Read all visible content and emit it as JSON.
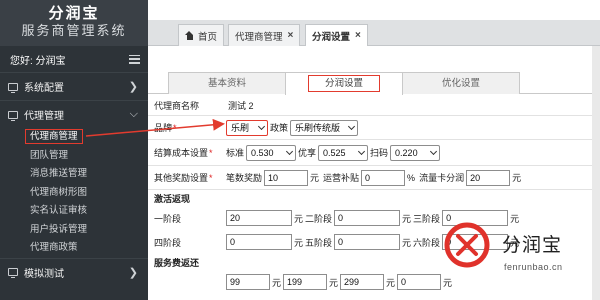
{
  "sidebar": {
    "brand_name": "分润宝",
    "brand_subtitle": "服务商管理系统",
    "greeting": "您好:  分润宝",
    "sections": [
      {
        "label": "系统配置",
        "icon": "monitor-icon"
      },
      {
        "label": "代理管理",
        "icon": "monitor-icon"
      },
      {
        "label": "模拟测试",
        "icon": "monitor-icon"
      }
    ],
    "agent_items": [
      "代理商管理",
      "团队管理",
      "消息推送管理",
      "代理商树形图",
      "实名认证审核",
      "用户投诉管理",
      "代理商政策"
    ]
  },
  "tabs": [
    {
      "label": "首页",
      "icon": "home-icon"
    },
    {
      "label": "代理商管理",
      "close": "×"
    },
    {
      "label": "分润设置",
      "close": "×"
    }
  ],
  "content_tabs": [
    "基本资料",
    "分润设置",
    "优化设置"
  ],
  "form": {
    "agent_name_label": "代理商名称",
    "agent_name_value": "测试 2",
    "brand_label": "品牌",
    "brand_value": "乐刷",
    "policy_label": "政策",
    "policy_value": "乐刷传统版",
    "cost_label": "结算成本设置",
    "standard_label": "标准",
    "standard_value": "0.530",
    "preferred_label": "优享",
    "preferred_value": "0.525",
    "scan_label": "扫码",
    "scan_value": "0.220",
    "reward_label": "其他奖励设置",
    "deal_reward_label": "笔数奖励",
    "deal_reward_value": "10",
    "deal_reward_unit": "元",
    "subsidy_label": "运营补贴",
    "subsidy_value": "0",
    "subsidy_unit": "%",
    "flow_label": "流量卡分润",
    "flow_value": "20",
    "flow_unit": "元",
    "activation_title": "激活返现",
    "stages": [
      {
        "label": "一阶段",
        "value": "20",
        "unit": "元"
      },
      {
        "label": "二阶段",
        "value": "0",
        "unit": "元"
      },
      {
        "label": "三阶段",
        "value": "0",
        "unit": "元"
      },
      {
        "label": "四阶段",
        "value": "0",
        "unit": "元"
      },
      {
        "label": "五阶段",
        "value": "0",
        "unit": "元"
      },
      {
        "label": "六阶段",
        "value": "0",
        "unit": "元"
      }
    ],
    "service_fee_title": "服务费返还",
    "service_fees": [
      {
        "value": "99",
        "unit": "元"
      },
      {
        "value": "199",
        "unit": "元"
      },
      {
        "value": "299",
        "unit": "元"
      },
      {
        "value": "0",
        "unit": "元"
      }
    ],
    "required_mark": "*"
  },
  "watermark": {
    "name": "分润宝",
    "url": "fenrunbao.cn"
  },
  "colors": {
    "sidebar_bg": "#2d3338",
    "highlight": "#e23b2e",
    "logo_red": "#e0322b"
  }
}
